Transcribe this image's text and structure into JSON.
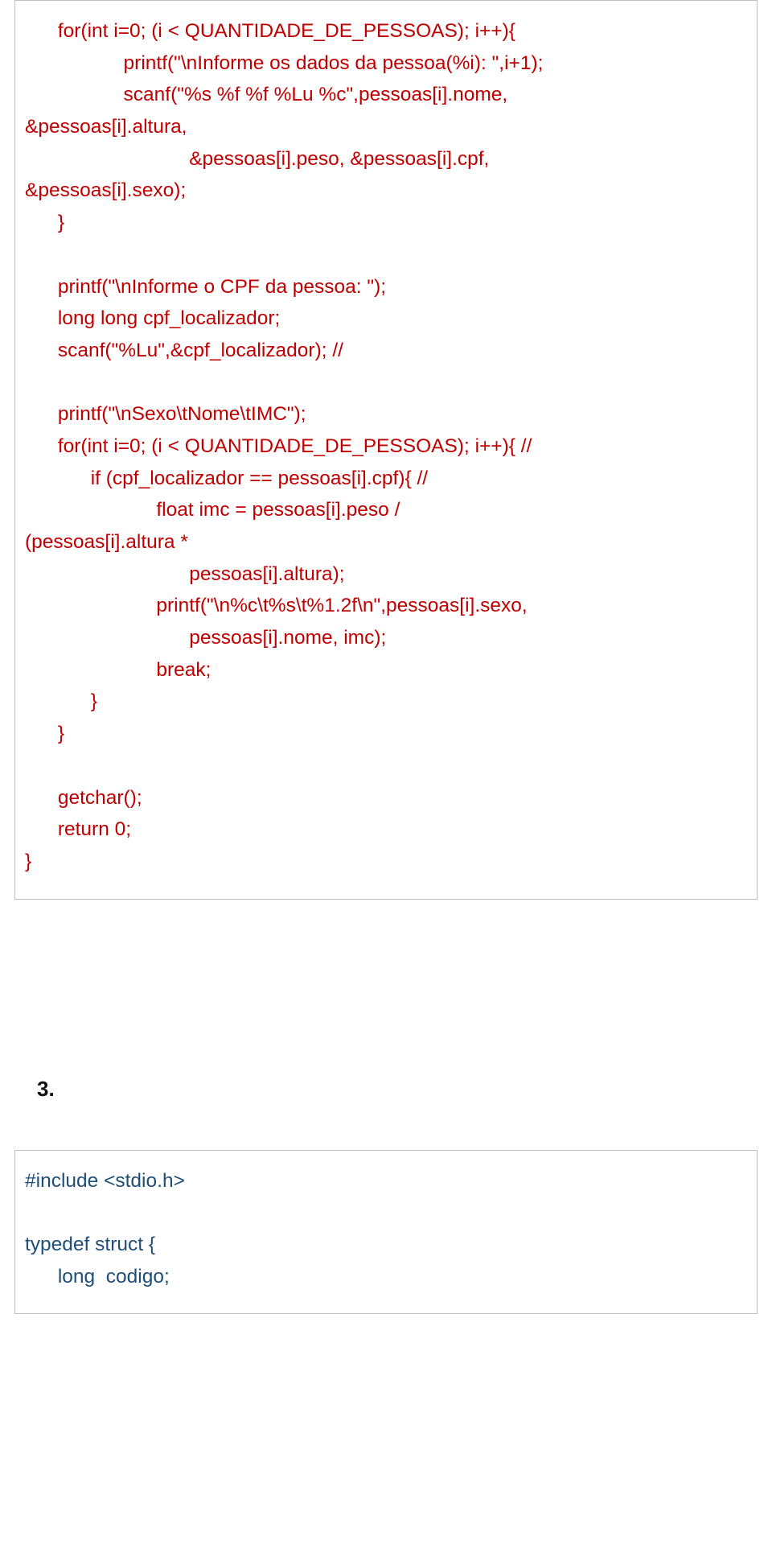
{
  "block1": {
    "code": "      for(int i=0; (i < QUANTIDADE_DE_PESSOAS); i++){\n                  printf(\"\\nInforme os dados da pessoa(%i): \",i+1);\n                  scanf(\"%s %f %f %Lu %c\",pessoas[i].nome,\n&pessoas[i].altura,\n                              &pessoas[i].peso, &pessoas[i].cpf,\n&pessoas[i].sexo);\n      }\n\n      printf(\"\\nInforme o CPF da pessoa: \");\n      long long cpf_localizador;\n      scanf(\"%Lu\",&cpf_localizador); //\n\n      printf(\"\\nSexo\\tNome\\tIMC\");\n      for(int i=0; (i < QUANTIDADE_DE_PESSOAS); i++){ //\n            if (cpf_localizador == pessoas[i].cpf){ //\n                        float imc = pessoas[i].peso /\n(pessoas[i].altura *\n                              pessoas[i].altura);\n                        printf(\"\\n%c\\t%s\\t%1.2f\\n\",pessoas[i].sexo,\n                              pessoas[i].nome, imc);\n                        break;\n            }\n      }\n\n      getchar();\n      return 0;\n}"
  },
  "sectionLabel": "3.",
  "block2": {
    "code": "#include <stdio.h>\n\ntypedef struct {\n      long  codigo;"
  }
}
